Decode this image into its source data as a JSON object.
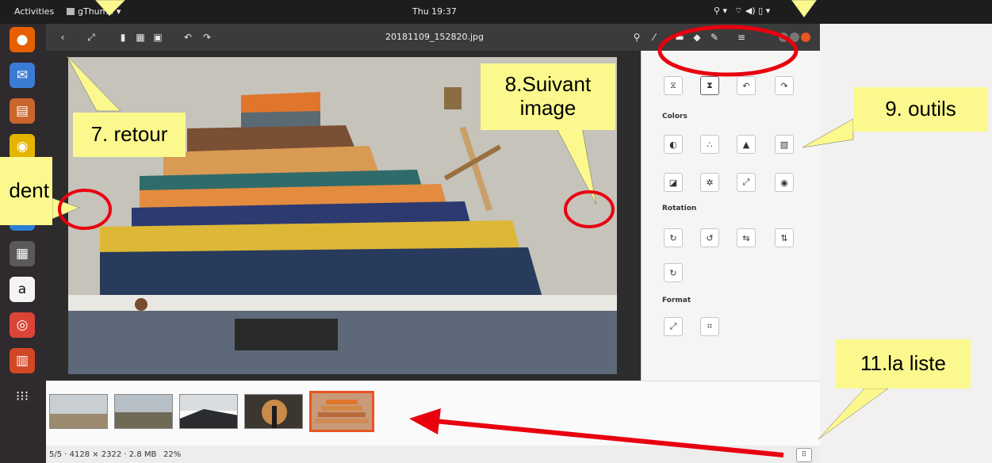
{
  "topbar": {
    "activities": "Activities",
    "app_name": "gThumb ▾",
    "clock": "Thu 19:37",
    "tray": [
      "⚲ ▾",
      "⌔ ◀) ▯ ▾"
    ]
  },
  "dock": {
    "icons": [
      {
        "name": "firefox-icon",
        "glyph": "●",
        "color": "#e66000"
      },
      {
        "name": "thunderbird-icon",
        "glyph": "✉",
        "color": "#3a7bd5"
      },
      {
        "name": "files-icon",
        "glyph": "▤",
        "color": "#c9652d"
      },
      {
        "name": "rhythmbox-icon",
        "glyph": "◉",
        "color": "#e4b500"
      },
      {
        "name": "software-icon",
        "glyph": "▣",
        "color": "#d04020"
      },
      {
        "name": "help-icon",
        "glyph": "?",
        "color": "#2d7fd3"
      },
      {
        "name": "shotwell-icon",
        "glyph": "▦",
        "color": "#7a8a99"
      },
      {
        "name": "amazon-icon",
        "glyph": "a",
        "color": "#f4f4f4"
      },
      {
        "name": "chrome-icon",
        "glyph": "◎",
        "color": "#db4437"
      },
      {
        "name": "impress-icon",
        "glyph": "▥",
        "color": "#d24726"
      },
      {
        "name": "app-grid-icon",
        "glyph": "⁝⁝⁝",
        "color": "#2e2a2d"
      }
    ]
  },
  "header": {
    "filename": "20181109_152820.jpg",
    "left_buttons": [
      "‹",
      "⤢",
      "▮",
      "▦",
      "▣",
      "↶",
      "↷"
    ],
    "right_buttons": [
      "⚲",
      "⁄",
      "▬",
      "◆",
      "✎",
      "≡"
    ]
  },
  "tools": {
    "top_row": [
      "⧖",
      "⧗",
      "↶",
      "↷"
    ],
    "colors_label": "Colors",
    "colors_row1": [
      "◐",
      "∴",
      "▲",
      "▧"
    ],
    "colors_row2": [
      "◪",
      "✲",
      "⤢",
      "◉"
    ],
    "rotation_label": "Rotation",
    "rotation_row": [
      "↻",
      "↺",
      "⇆",
      "⇅"
    ],
    "rotation_row2": [
      "↻"
    ],
    "format_label": "Format",
    "format_row": [
      "⤢",
      "⌗"
    ]
  },
  "status": {
    "info": "5/5 · 4128 × 2322 · 2.8 MB",
    "zoom": "22%",
    "button": "⠿"
  },
  "callouts": {
    "retour": "7. retour",
    "suivant": "8.Suivant image",
    "outils": "9. outils",
    "precedent": "dent",
    "liste": "11.la liste"
  },
  "colors": {
    "accent": "#e95420",
    "callout": "#fbf98d",
    "annotation": "#e8000f"
  }
}
